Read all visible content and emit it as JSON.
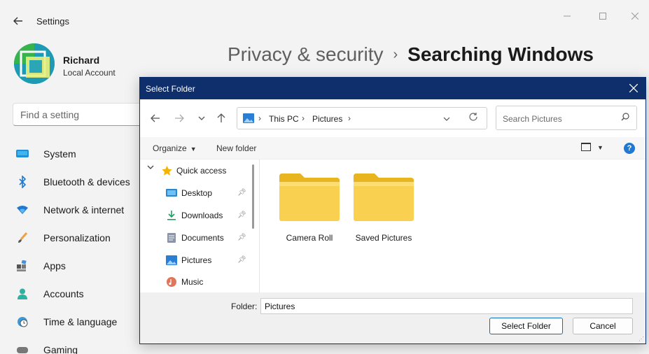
{
  "settings": {
    "app_title": "Settings",
    "profile": {
      "name": "Richard",
      "account_type": "Local Account"
    },
    "search_placeholder": "Find a setting",
    "header": {
      "parent": "Privacy & security",
      "separator": "›",
      "current": "Searching Windows"
    },
    "nav_items": [
      {
        "label": "System",
        "icon": "monitor-icon"
      },
      {
        "label": "Bluetooth & devices",
        "icon": "bluetooth-icon"
      },
      {
        "label": "Network & internet",
        "icon": "wifi-icon"
      },
      {
        "label": "Personalization",
        "icon": "brush-icon"
      },
      {
        "label": "Apps",
        "icon": "apps-icon"
      },
      {
        "label": "Accounts",
        "icon": "person-icon"
      },
      {
        "label": "Time & language",
        "icon": "clock-globe-icon"
      },
      {
        "label": "Gaming",
        "icon": "gamepad-icon"
      }
    ]
  },
  "dialog": {
    "title": "Select Folder",
    "address": {
      "segments": [
        "This PC",
        "Pictures"
      ],
      "separator": "›"
    },
    "search_placeholder": "Search Pictures",
    "commands": {
      "organize": "Organize",
      "new_folder": "New folder",
      "help": "?"
    },
    "tree": {
      "quick_access": "Quick access",
      "items": [
        {
          "label": "Desktop",
          "pinned": true,
          "icon": "desktop-icon"
        },
        {
          "label": "Downloads",
          "pinned": true,
          "icon": "download-icon"
        },
        {
          "label": "Documents",
          "pinned": true,
          "icon": "documents-icon"
        },
        {
          "label": "Pictures",
          "pinned": true,
          "icon": "pictures-icon"
        },
        {
          "label": "Music",
          "pinned": false,
          "icon": "music-icon"
        }
      ]
    },
    "folders": [
      {
        "label": "Camera Roll"
      },
      {
        "label": "Saved Pictures"
      }
    ],
    "footer": {
      "folder_label": "Folder:",
      "folder_value": "Pictures",
      "select_button": "Select Folder",
      "cancel_button": "Cancel"
    }
  },
  "colors": {
    "dialog_title_bg": "#0e2f6b",
    "accent": "#0f6cbd",
    "folder_yellow": "#f9d04f"
  }
}
